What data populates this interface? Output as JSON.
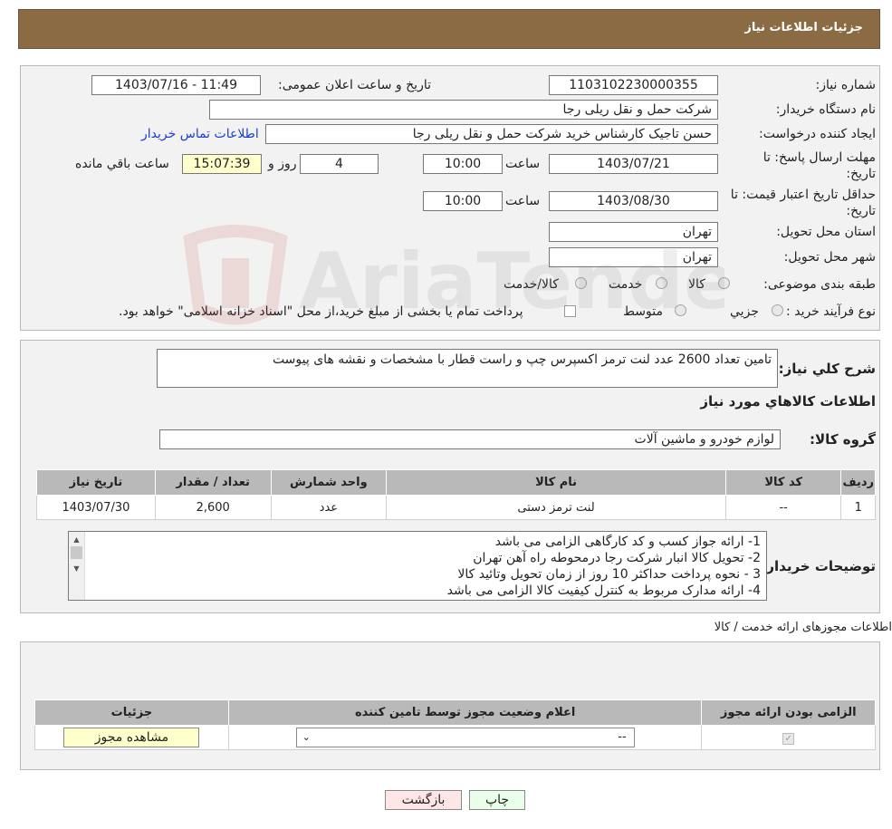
{
  "header": {
    "title": "جزئیات اطلاعات نیاز"
  },
  "form": {
    "need_number_label": "شماره نیاز:",
    "need_number": "1103102230000355",
    "announce_label": "تاریخ و ساعت اعلان عمومی:",
    "announce_value": "1403/07/16 - 11:49",
    "buyer_label": "نام دستگاه خریدار:",
    "buyer_value": "شرکت حمل و نقل ریلی رجا",
    "creator_label": "ایجاد کننده درخواست:",
    "creator_value": "حسن تاجیک کارشناس خرید شرکت حمل و نقل ریلی رجا",
    "contact_link": "اطلاعات تماس خریدار",
    "deadline_label_1": "مهلت ارسال پاسخ: تا",
    "deadline_label_2": "تاریخ:",
    "deadline_date": "1403/07/21",
    "time_label": "ساعت",
    "deadline_time": "10:00",
    "days_value": "4",
    "days_label": "روز و",
    "remaining_time": "15:07:39",
    "remaining_label": "ساعت باقي مانده",
    "validity_label_1": "حداقل تاریخ اعتبار قیمت: تا",
    "validity_label_2": "تاریخ:",
    "validity_date": "1403/08/30",
    "validity_time": "10:00",
    "province_label": "استان محل تحویل:",
    "province_value": "تهران",
    "city_label": "شهر محل تحویل:",
    "city_value": "تهران",
    "category_label": "طبقه بندی موضوعی:",
    "category_options": [
      "کالا",
      "خدمت",
      "کالا/خدمت"
    ],
    "process_label": "نوع فرآیند خرید :",
    "process_options": [
      "جزیي",
      "متوسط"
    ],
    "process_note": "پرداخت تمام یا بخشی از مبلغ خرید،از محل \"اسناد خزانه اسلامی\" خواهد بود."
  },
  "summary": {
    "label": "شرح کلي نياز:",
    "value": "تامین تعداد 2600 عدد لنت ترمز اکسپرس چپ و راست قطار با مشخصات و نقشه های پیوست"
  },
  "goods": {
    "section_title": "اطلاعات کالاهاي مورد نياز",
    "group_label": "گروه کالا:",
    "group_value": "لوازم خودرو و ماشین آلات",
    "columns": [
      "رديف",
      "کد کالا",
      "نام کالا",
      "واحد شمارش",
      "تعداد / مقدار",
      "تاریخ نیاز"
    ],
    "rows": [
      [
        "1",
        "--",
        "لنت ترمز دستی",
        "عدد",
        "2,600",
        "1403/07/30"
      ]
    ]
  },
  "buyer_notes": {
    "label": "توضیحات خریدار:",
    "lines": [
      "1- ارائه جواز کسب و کد کارگاهی الزامی  می باشد",
      "2- تحویل کالا انبار شرکت رجا درمحوطه راه آهن تهران",
      "3 - نحوه پرداخت حداکثر 10 روز از زمان تحویل وتائید کالا",
      "4- ارائه مدارک مربوط به کنترل کیفیت کالا الزامی می باشد"
    ]
  },
  "permits": {
    "section_title": "اطلاعات مجوزهای ارائه خدمت / کالا",
    "columns": [
      "الزامی بودن ارائه مجوز",
      "اعلام وضعیت مجوز توسط تامین کننده",
      "جزئیات"
    ],
    "select_value": "--",
    "view_button": "مشاهده مجوز"
  },
  "actions": {
    "print": "چاپ",
    "back": "بازگشت"
  },
  "watermark": {
    "text": "AriaTender.neT"
  }
}
